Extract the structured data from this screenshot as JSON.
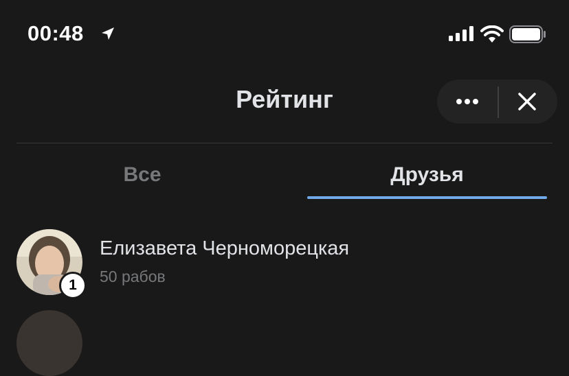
{
  "status_bar": {
    "time": "00:48",
    "icons": [
      "location-arrow-icon",
      "cellular-signal-icon",
      "wifi-icon",
      "battery-icon"
    ]
  },
  "header": {
    "title": "Рейтинг",
    "more_icon": "more-horizontal-icon",
    "close_icon": "close-icon"
  },
  "tabs": [
    {
      "label": "Все",
      "selected": false
    },
    {
      "label": "Друзья",
      "selected": true
    }
  ],
  "ranking": [
    {
      "rank": "1",
      "name": "Елизавета Черноморецкая",
      "subtitle": "50 рабов"
    }
  ],
  "colors": {
    "background": "#19191a",
    "tab_accent": "#71aaeb",
    "text_primary": "#e1e3e6",
    "text_secondary": "#76787a"
  }
}
